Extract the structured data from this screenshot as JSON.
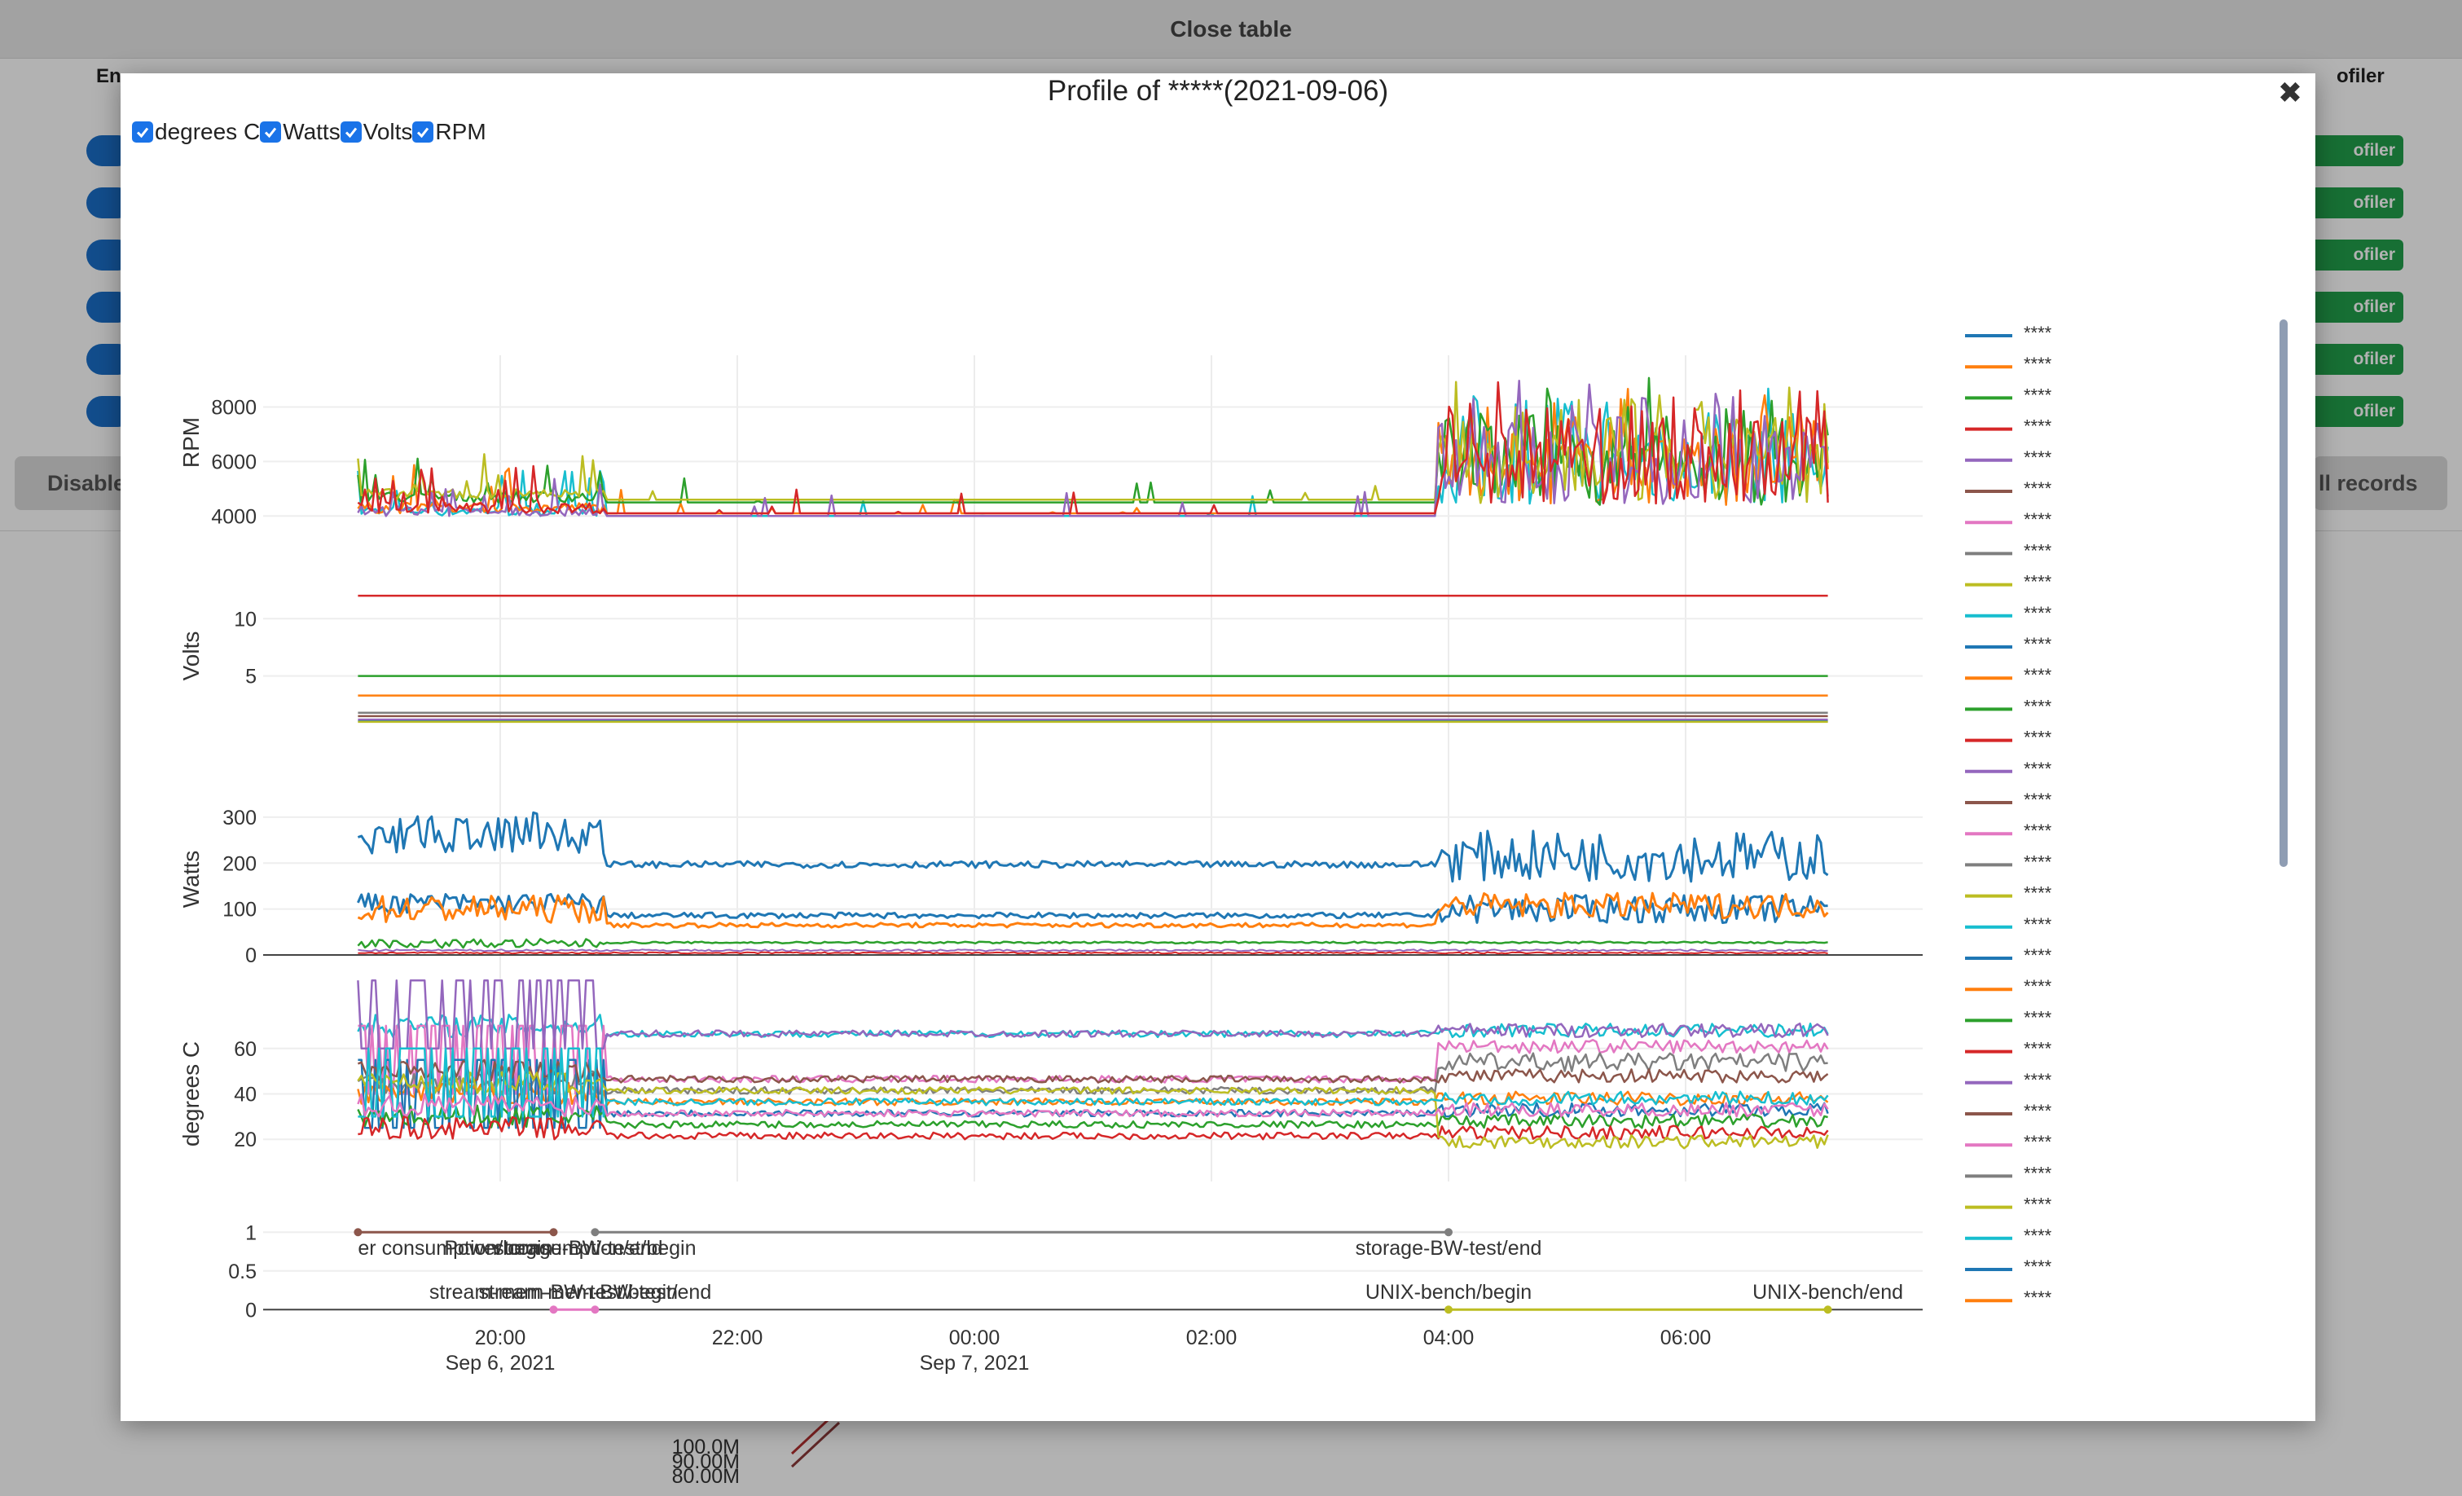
{
  "background": {
    "close_table_label": "Close table",
    "col_left_label": "En",
    "col_right_label": "ofiler",
    "profiler_button_label": "ofiler",
    "left_button_label": "Disable",
    "right_button_label": "ll records",
    "bg_chart_ticks": [
      "100.0M",
      "90.00M",
      "80.00M"
    ]
  },
  "modal": {
    "title": "Profile of *****(2021-09-06)",
    "close_icon": "close-icon",
    "toggles": [
      {
        "label": "degrees C",
        "checked": true
      },
      {
        "label": "Watts",
        "checked": true
      },
      {
        "label": "Volts",
        "checked": true
      },
      {
        "label": "RPM",
        "checked": true
      }
    ]
  },
  "chart_data": {
    "type": "line",
    "title": "",
    "x_axis": {
      "ticks": [
        {
          "label": "20:00",
          "sub": "Sep 6, 2021",
          "hour": 20
        },
        {
          "label": "22:00",
          "sub": "",
          "hour": 22
        },
        {
          "label": "00:00",
          "sub": "Sep 7, 2021",
          "hour": 24
        },
        {
          "label": "02:00",
          "sub": "",
          "hour": 26
        },
        {
          "label": "04:00",
          "sub": "",
          "hour": 28
        },
        {
          "label": "06:00",
          "sub": "",
          "hour": 30
        }
      ],
      "range_hours": [
        18.0,
        32.0
      ],
      "data_range_hours": [
        18.8,
        31.2
      ]
    },
    "subplots": [
      {
        "ylabel": "RPM",
        "ticks": [
          4000,
          6000,
          8000
        ],
        "ylim": [
          3800,
          9600
        ],
        "baseline_values": [
          4000,
          4100,
          4500,
          4600
        ],
        "post_04_range": [
          4000,
          9200
        ]
      },
      {
        "ylabel": "Volts",
        "ticks": [
          5,
          10
        ],
        "ylim": [
          0,
          13.5
        ],
        "level_values": [
          12,
          5,
          3.3,
          1.8,
          1.5,
          1.2,
          1.05,
          1.0
        ]
      },
      {
        "ylabel": "Watts",
        "ticks": [
          0,
          100,
          200,
          300
        ],
        "ylim": [
          0,
          330
        ],
        "typical_values": [
          200,
          80,
          60,
          25,
          8
        ]
      },
      {
        "ylabel": "degrees C",
        "ticks": [
          20,
          40,
          60
        ],
        "ylim": [
          5,
          75
        ],
        "typical_values": [
          65,
          45,
          40,
          35,
          30,
          25,
          20
        ]
      },
      {
        "ylabel": "",
        "ticks": [
          0,
          0.5,
          1
        ],
        "ylim": [
          -0.05,
          1.15
        ]
      }
    ],
    "annotations_top": [
      {
        "text": "er consumption/begin",
        "start_hour": 18.8,
        "end_hour": 20.45,
        "color": "#8c564b"
      },
      {
        "text": "Power consumption/end",
        "start_hour": 18.8,
        "end_hour": 20.45,
        "color": "#8c564b"
      },
      {
        "text": "storage-BW-test/begin",
        "start_hour": 20.8,
        "end_hour": 28.0,
        "color": "#7f7f7f"
      },
      {
        "text": "storage-BW-test/end",
        "start_hour": 20.8,
        "end_hour": 28.0,
        "color": "#7f7f7f"
      }
    ],
    "annotations_bottom": [
      {
        "text": "stream-mem-BW-test/begin",
        "start_hour": 20.45,
        "end_hour": 20.8,
        "color": "#e377c2"
      },
      {
        "text": "stream-mem-BW-test/end",
        "start_hour": 20.45,
        "end_hour": 20.8,
        "color": "#e377c2"
      },
      {
        "text": "UNIX-bench/begin",
        "start_hour": 28.0,
        "end_hour": 31.2,
        "color": "#bcbd22"
      },
      {
        "text": "UNIX-bench/end",
        "start_hour": 28.0,
        "end_hour": 31.2,
        "color": "#bcbd22"
      }
    ],
    "legend": {
      "placement": "right",
      "entries": [
        "****",
        "****",
        "****",
        "****",
        "****",
        "****",
        "****",
        "****",
        "****",
        "****",
        "****",
        "****",
        "****",
        "****",
        "****",
        "****",
        "****",
        "****",
        "****",
        "****",
        "****",
        "****",
        "****",
        "****",
        "****",
        "****",
        "****",
        "****",
        "****",
        "****",
        "****",
        "****",
        "****"
      ]
    },
    "palette": [
      "#1f77b4",
      "#ff7f0e",
      "#2ca02c",
      "#d62728",
      "#9467bd",
      "#8c564b",
      "#e377c2",
      "#7f7f7f",
      "#bcbd22",
      "#17becf"
    ]
  }
}
